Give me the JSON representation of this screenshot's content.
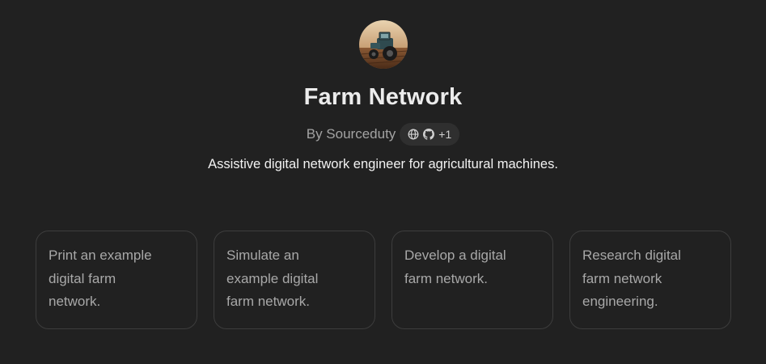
{
  "gpt": {
    "name": "Farm Network",
    "author_prefix": "By Sourceduty",
    "badge_icons": [
      "globe-icon",
      "github-icon"
    ],
    "badge_more": "+1",
    "description": "Assistive digital network engineer for agricultural machines.",
    "avatar_icon": "tractor-avatar"
  },
  "conversation_starters": [
    {
      "label": "Print an example digital farm network."
    },
    {
      "label": "Simulate an example digital farm network."
    },
    {
      "label": "Develop a digital farm network."
    },
    {
      "label": "Research digital farm network engineering."
    }
  ]
}
